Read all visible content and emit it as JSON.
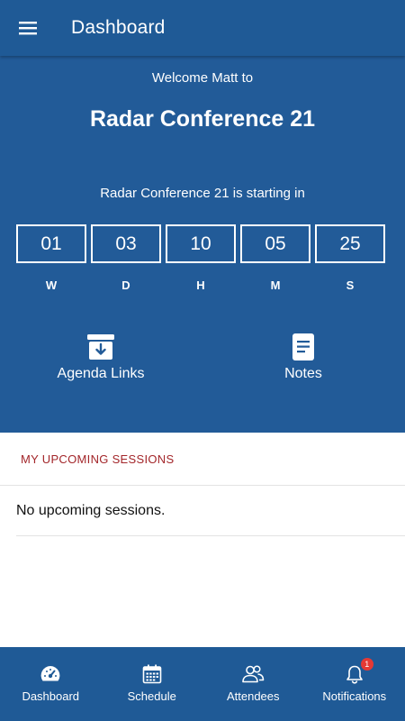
{
  "header": {
    "title": "Dashboard",
    "menu_icon": "hamburger-menu-icon"
  },
  "hero": {
    "welcome": "Welcome Matt to",
    "event_title": "Radar Conference 21",
    "starting_text": "Radar Conference 21 is starting in",
    "countdown": [
      {
        "value": "01",
        "unit": "W"
      },
      {
        "value": "03",
        "unit": "D"
      },
      {
        "value": "10",
        "unit": "H"
      },
      {
        "value": "05",
        "unit": "M"
      },
      {
        "value": "25",
        "unit": "S"
      }
    ],
    "actions": [
      {
        "label": "Agenda Links",
        "icon": "archive-download-icon"
      },
      {
        "label": "Notes",
        "icon": "notes-document-icon"
      }
    ]
  },
  "sessions": {
    "header": "MY UPCOMING SESSIONS",
    "empty_text": "No upcoming sessions."
  },
  "bottom_nav": {
    "items": [
      {
        "label": "Dashboard",
        "icon": "speedometer-icon"
      },
      {
        "label": "Schedule",
        "icon": "calendar-icon"
      },
      {
        "label": "Attendees",
        "icon": "people-icon"
      },
      {
        "label": "Notifications",
        "icon": "bell-icon",
        "badge": "1"
      }
    ]
  },
  "colors": {
    "primary": "#225b98",
    "accent_text": "#a3262a",
    "badge": "#e53935"
  }
}
